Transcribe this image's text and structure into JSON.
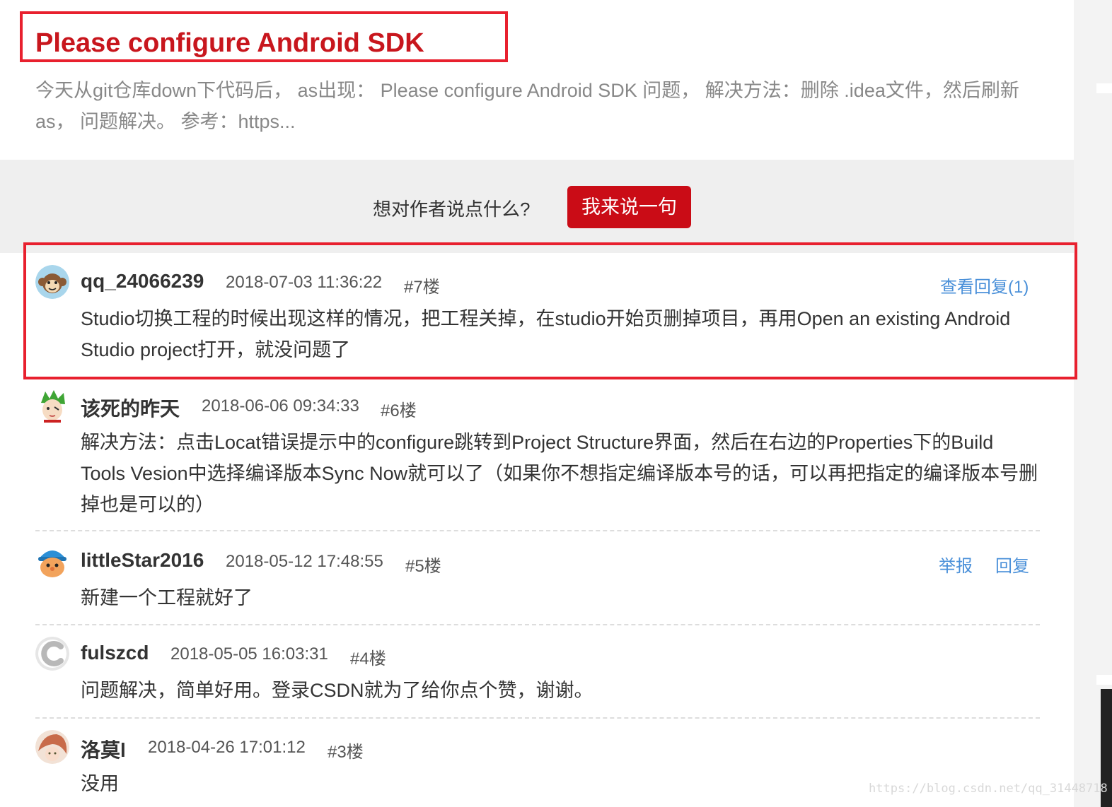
{
  "article": {
    "title": "Please configure Android SDK",
    "summary": "今天从git仓库down下代码后， as出现： Please configure Android SDK 问题， 解决方法：删除 .idea文件，然后刷新as， 问题解决。 参考：https..."
  },
  "comment_bar": {
    "prompt": "想对作者说点什么?",
    "button_label": "我来说一句"
  },
  "comments": [
    {
      "username": "qq_24066239",
      "time": "2018-07-03 11:36:22",
      "floor": "#7楼",
      "view_replies": "查看回复(1)",
      "text": "Studio切换工程的时候出现这样的情况，把工程关掉，在studio开始页删掉项目，再用Open an existing Android Studio project打开，就没问题了",
      "avatar_icon": "monkey-avatar-icon"
    },
    {
      "username": "该死的昨天",
      "time": "2018-06-06 09:34:33",
      "floor": "#6楼",
      "text": "解决方法：点击Locat错误提示中的configure跳转到Project Structure界面，然后在右边的Properties下的Build Tools Vesion中选择编译版本Sync Now就可以了（如果你不想指定编译版本号的话，可以再把指定的编译版本号删掉也是可以的）",
      "avatar_icon": "anime-character-avatar-icon"
    },
    {
      "username": "littleStar2016",
      "time": "2018-05-12 17:48:55",
      "floor": "#5楼",
      "report": "举报",
      "reply": "回复",
      "text": "新建一个工程就好了",
      "avatar_icon": "cartoon-boy-avatar-icon"
    },
    {
      "username": "fulszcd",
      "time": "2018-05-05 16:03:31",
      "floor": "#4楼",
      "text": "问题解决，简单好用。登录CSDN就为了给你点个赞，谢谢。",
      "avatar_icon": "csdn-logo-avatar-icon"
    },
    {
      "username": "洛莫l",
      "time": "2018-04-26 17:01:12",
      "floor": "#3楼",
      "text": "没用",
      "avatar_icon": "photo-avatar-icon"
    }
  ],
  "watermark": "https://blog.csdn.net/qq_31448718",
  "colors": {
    "brand_red": "#ca0c16",
    "annotation_red": "#e8202e",
    "link_blue": "#4a90d9"
  }
}
